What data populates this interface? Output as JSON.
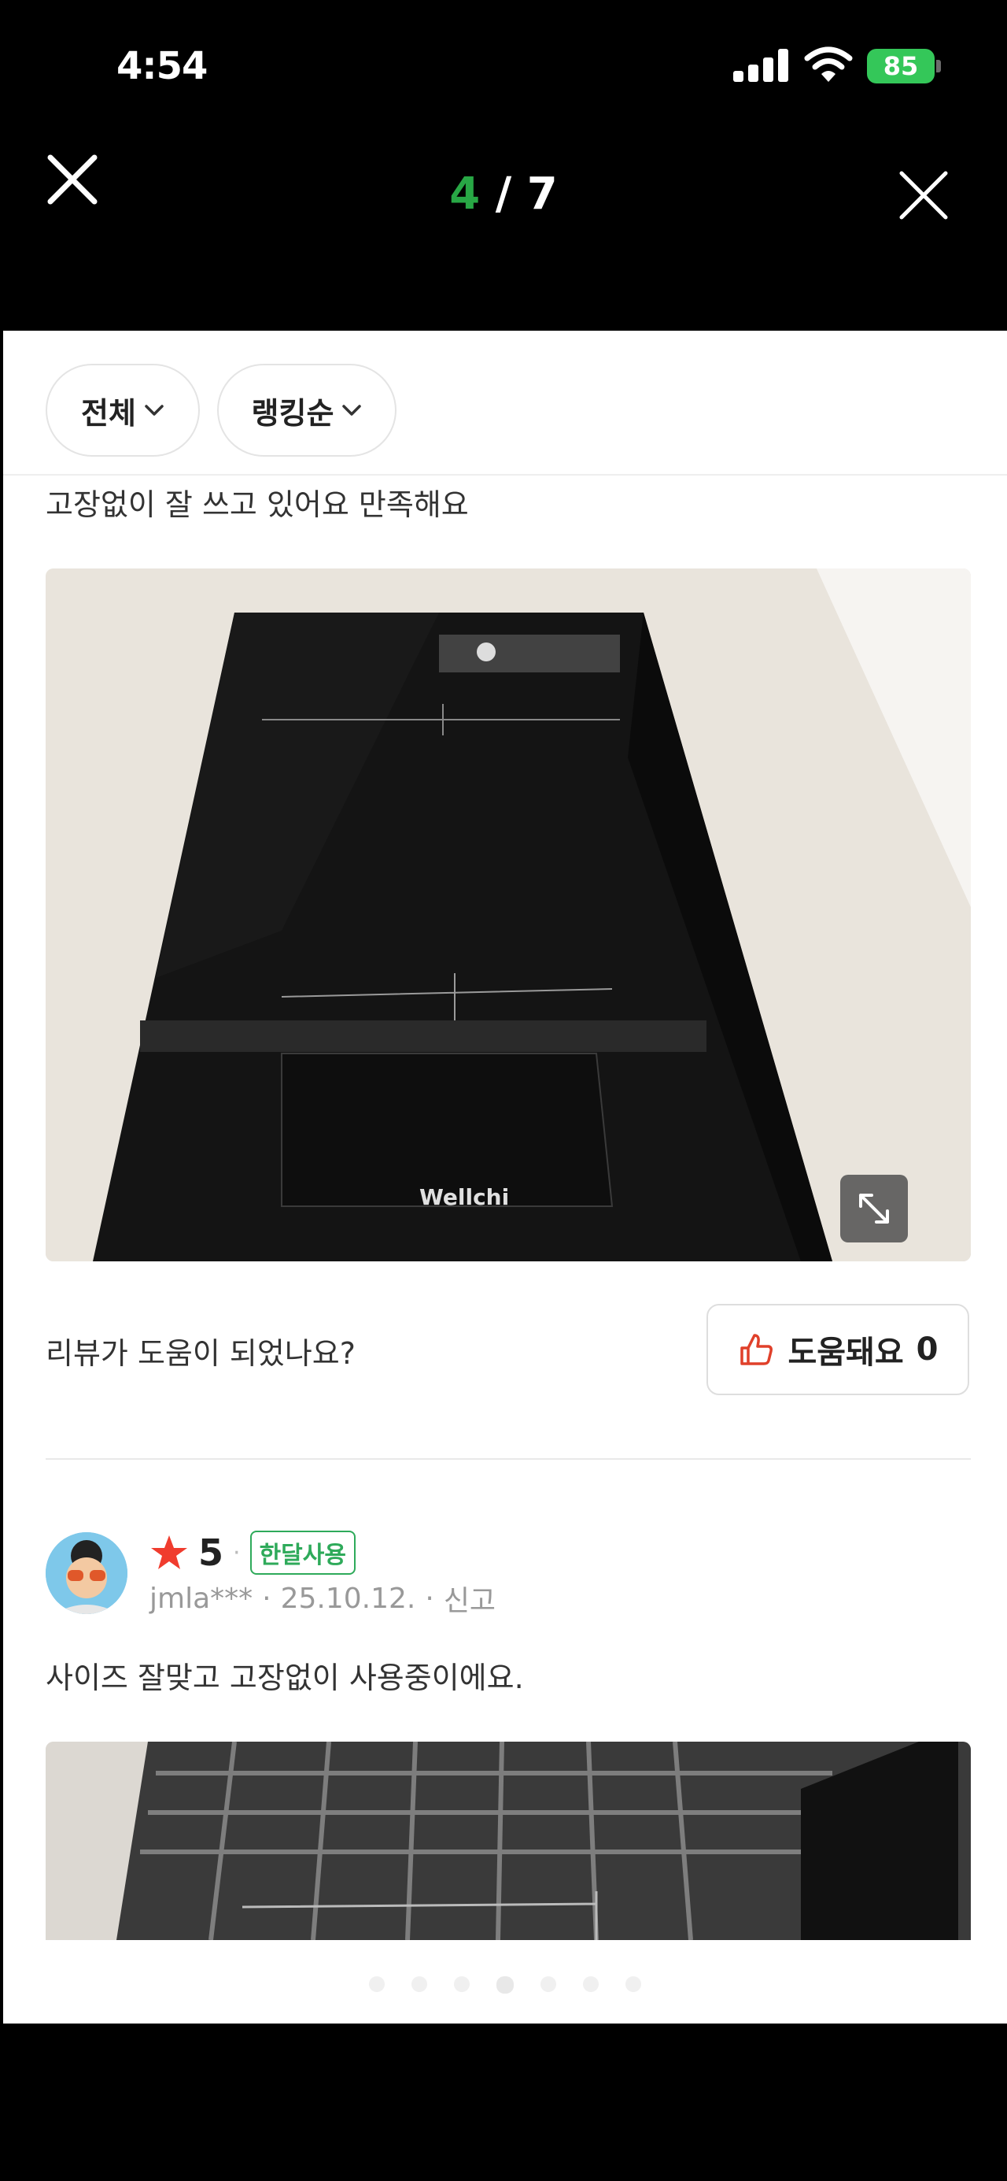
{
  "status_bar": {
    "time": "4:54",
    "battery": "85"
  },
  "viewer": {
    "current": "4",
    "separator": " / ",
    "total": "7"
  },
  "filters": {
    "filter_1": "전체",
    "filter_2": "랭킹순"
  },
  "review_1": {
    "text": "고장없이 잘 쓰고 있어요 만족해요",
    "photo_text": "Wellchi"
  },
  "helpful": {
    "question": "리뷰가 도움이 되었나요?",
    "button_label": "도움돼요",
    "count": "0"
  },
  "review_2": {
    "score": "5",
    "badge": "한달사용",
    "user": "jmla***",
    "date": "25.10.12.",
    "report": "신고",
    "text": "사이즈 잘맞고 고장없이 사용중이에요."
  },
  "pager": {
    "count": 7,
    "active_index": 3
  },
  "colors": {
    "accent_green": "#28a745",
    "badge_green": "#2eaa5a",
    "star_red": "#f03c2e",
    "battery_green": "#34c759"
  },
  "icons": [
    "close-icon",
    "chevron-down-icon",
    "expand-icon",
    "thumbs-up-icon",
    "star-icon"
  ]
}
